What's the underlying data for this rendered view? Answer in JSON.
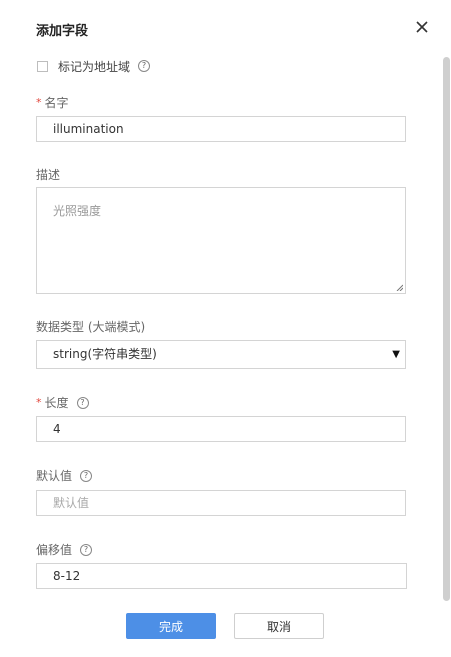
{
  "dialog": {
    "title": "添加字段",
    "close_icon": "close-icon"
  },
  "address_checkbox": {
    "label": "标记为地址域",
    "checked": false,
    "help_icon": "help-icon"
  },
  "fields": {
    "name": {
      "label": "名字",
      "required": true,
      "value": "illumination"
    },
    "description": {
      "label": "描述",
      "placeholder": "光照强度",
      "value": ""
    },
    "data_type": {
      "label": "数据类型 (大端模式)",
      "selected": "string(字符串类型)"
    },
    "length": {
      "label": "长度",
      "required": true,
      "value": "4"
    },
    "default_value": {
      "label": "默认值",
      "placeholder": "默认值",
      "value": ""
    },
    "offset": {
      "label": "偏移值",
      "value": "8-12"
    }
  },
  "buttons": {
    "confirm": "完成",
    "cancel": "取消"
  },
  "colors": {
    "primary": "#4d8fe6",
    "required_mark": "#e0463c",
    "border": "#d4d4d4"
  }
}
